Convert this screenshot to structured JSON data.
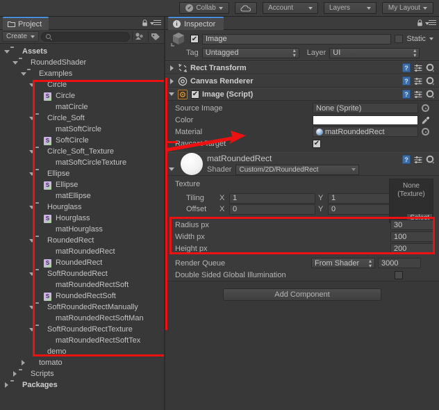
{
  "toolbar": {
    "collab_label": "Collab",
    "collab_check_glyph": "✔",
    "account_label": "Account",
    "layers_label": "Layers",
    "layout_label": "My Layout"
  },
  "project_panel": {
    "tab_label": "Project",
    "create_label": "Create",
    "search_value": "",
    "search_placeholder": "",
    "tree": [
      {
        "depth": 0,
        "twirl": "down",
        "icon": "folder",
        "label": "Assets",
        "bold": true
      },
      {
        "depth": 1,
        "twirl": "down",
        "icon": "folder",
        "label": "RoundedShader",
        "bold": false
      },
      {
        "depth": 2,
        "twirl": "down",
        "icon": "folder",
        "label": "Examples",
        "bold": false
      },
      {
        "depth": 3,
        "twirl": "down",
        "icon": "folder",
        "label": "Circle",
        "bold": false
      },
      {
        "depth": 4,
        "twirl": "none",
        "icon": "script",
        "label": "Circle",
        "bold": false
      },
      {
        "depth": 4,
        "twirl": "none",
        "icon": "sphere",
        "label": "matCircle",
        "bold": false
      },
      {
        "depth": 3,
        "twirl": "down",
        "icon": "folder",
        "label": "Circle_Soft",
        "bold": false
      },
      {
        "depth": 4,
        "twirl": "none",
        "icon": "sphere",
        "label": "matSoftCircle",
        "bold": false
      },
      {
        "depth": 4,
        "twirl": "none",
        "icon": "script",
        "label": "SoftCircle",
        "bold": false
      },
      {
        "depth": 3,
        "twirl": "down",
        "icon": "folder",
        "label": "Circle_Soft_Texture",
        "bold": false
      },
      {
        "depth": 4,
        "twirl": "none",
        "icon": "sphere",
        "label": "matSoftCircleTexture",
        "bold": false
      },
      {
        "depth": 3,
        "twirl": "down",
        "icon": "folder",
        "label": "Ellipse",
        "bold": false
      },
      {
        "depth": 4,
        "twirl": "none",
        "icon": "script",
        "label": "Ellipse",
        "bold": false
      },
      {
        "depth": 4,
        "twirl": "none",
        "icon": "sphere",
        "label": "matEllipse",
        "bold": false
      },
      {
        "depth": 3,
        "twirl": "down",
        "icon": "folder",
        "label": "Hourglass",
        "bold": false
      },
      {
        "depth": 4,
        "twirl": "none",
        "icon": "script",
        "label": "Hourglass",
        "bold": false
      },
      {
        "depth": 4,
        "twirl": "none",
        "icon": "sphere",
        "label": "matHourglass",
        "bold": false
      },
      {
        "depth": 3,
        "twirl": "down",
        "icon": "folder",
        "label": "RoundedRect",
        "bold": false
      },
      {
        "depth": 4,
        "twirl": "none",
        "icon": "sphere",
        "label": "matRoundedRect",
        "bold": false
      },
      {
        "depth": 4,
        "twirl": "none",
        "icon": "script",
        "label": "RoundedRect",
        "bold": false
      },
      {
        "depth": 3,
        "twirl": "down",
        "icon": "folder",
        "label": "SoftRoundedRect",
        "bold": false
      },
      {
        "depth": 4,
        "twirl": "none",
        "icon": "sphere",
        "label": "matRoundedRectSoft",
        "bold": false
      },
      {
        "depth": 4,
        "twirl": "none",
        "icon": "script",
        "label": "RoundedRectSoft",
        "bold": false
      },
      {
        "depth": 3,
        "twirl": "down",
        "icon": "folder",
        "label": "SoftRoundedRectManually",
        "bold": false
      },
      {
        "depth": 4,
        "twirl": "none",
        "icon": "sphere",
        "label": "matRoundedRectSoftMan",
        "bold": false
      },
      {
        "depth": 3,
        "twirl": "down",
        "icon": "folder",
        "label": "SoftRoundedRectTexture",
        "bold": false
      },
      {
        "depth": 4,
        "twirl": "none",
        "icon": "sphere",
        "label": "matRoundedRectSoftTex",
        "bold": false
      },
      {
        "depth": 3,
        "twirl": "none",
        "icon": "scene",
        "label": "demo",
        "bold": false
      },
      {
        "depth": 2,
        "twirl": "right",
        "icon": "texture",
        "label": "tomato",
        "bold": false
      },
      {
        "depth": 1,
        "twirl": "right",
        "icon": "folder",
        "label": "Scripts",
        "bold": false
      },
      {
        "depth": 0,
        "twirl": "right",
        "icon": "folder",
        "label": "Packages",
        "bold": true
      }
    ]
  },
  "inspector": {
    "tab_label": "Inspector",
    "gameobject": {
      "enabled_glyph": "✔",
      "name": "Image",
      "static_label": "Static",
      "tag_label": "Tag",
      "tag_value": "Untagged",
      "layer_label": "Layer",
      "layer_value": "UI"
    },
    "components": [
      {
        "title": "Rect Transform",
        "expanded": false
      },
      {
        "title": "Canvas Renderer",
        "expanded": false
      }
    ],
    "image_script": {
      "title": "Image (Script)",
      "enabled_glyph": "✔",
      "source_image_label": "Source Image",
      "source_image_value": "None (Sprite)",
      "color_label": "Color",
      "color_value": "#FFFFFF",
      "material_label": "Material",
      "material_value": "matRoundedRect",
      "raycast_label": "Raycast Target",
      "raycast_checked_glyph": "✔"
    },
    "material": {
      "name": "matRoundedRect",
      "shader_label": "Shader",
      "shader_value": "Custom/2D/RoundedRect",
      "texture_label": "Texture",
      "texture_thumb_line1": "None",
      "texture_thumb_line2": "(Texture)",
      "texture_select_label": "Select",
      "tiling_label": "Tiling",
      "tiling_x_axis": "X",
      "tiling_x": "1",
      "tiling_y_axis": "Y",
      "tiling_y": "1",
      "offset_label": "Offset",
      "offset_x_axis": "X",
      "offset_x": "0",
      "offset_y_axis": "Y",
      "offset_y": "0",
      "params": [
        {
          "label": "Radius px",
          "value": "30"
        },
        {
          "label": "Width px",
          "value": "100"
        },
        {
          "label": "Height px",
          "value": "200"
        }
      ],
      "render_queue_label": "Render Queue",
      "render_queue_mode": "From Shader",
      "render_queue_value": "3000",
      "double_sided_label": "Double Sided Global Illumination"
    },
    "add_component_label": "Add Component"
  },
  "annotations": {
    "highlight_color": "#EE1111"
  }
}
